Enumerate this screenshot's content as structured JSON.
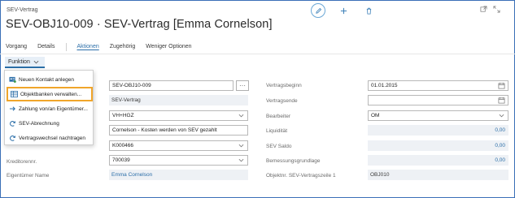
{
  "breadcrumb": "SEV-Vertrag",
  "title": "SEV-OBJ10-009 · SEV-Vertrag [Emma Cornelson]",
  "tabs": [
    "Vorgang",
    "Details",
    "Aktionen",
    "Zugehörig",
    "Weniger Optionen"
  ],
  "active_tab_index": 2,
  "function_button": "Funktion",
  "menu_items": [
    {
      "label": "Neuen Kontakt anlegen",
      "icon": "contact-card-icon"
    },
    {
      "label": "Objektbanken verwalten...",
      "icon": "bank-table-icon",
      "selected": true
    },
    {
      "label": "Zahlung von/an Eigentümer...",
      "icon": "payment-arrow-icon"
    },
    {
      "label": "SEV-Abrechnung",
      "icon": "refresh-cycle-icon"
    },
    {
      "label": "Vertragswechsel nachtragen",
      "icon": "contract-refresh-icon"
    }
  ],
  "left_fields": {
    "field1": "SEV-OBJ10-009",
    "field2": "SEV-Vertrag",
    "field3": "VH+HGZ",
    "field4": "Cornelson - Kosten werden von SEV gezahlt",
    "field5": "K000466",
    "kreditor_label": "Kreditorennr.",
    "kreditor_value": "700039",
    "owner_label": "Eigentümer Name",
    "owner_value": "Emma Cornelson"
  },
  "right_fields": {
    "vertragsbeginn_label": "Vertragsbeginn",
    "vertragsbeginn_value": "01.01.2015",
    "vertragsende_label": "Vertragsende",
    "vertragsende_value": "",
    "bearbeiter_label": "Bearbeiter",
    "bearbeiter_value": "OM",
    "liquiditaet_label": "Liquidität",
    "liquiditaet_value": "0,00",
    "sev_saldo_label": "SEV Saldo",
    "sev_saldo_value": "0,00",
    "bemessung_label": "Bemessungsgrundlage",
    "bemessung_value": "0,00",
    "objektnr_label": "Objektnr. SEV-Vertragszeile 1",
    "objektnr_value": "OBJ010"
  },
  "colors": {
    "accent": "#2b6ea8",
    "highlight": "#f0a52a",
    "field_bg": "#eef1f5"
  }
}
